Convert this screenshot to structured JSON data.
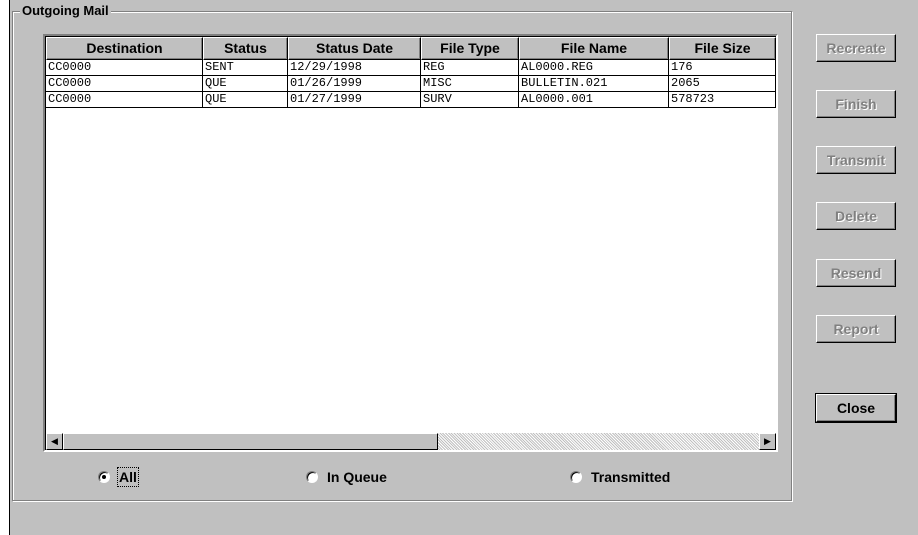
{
  "group_title": "Outgoing Mail",
  "columns": [
    "Destination",
    "Status",
    "Status Date",
    "File Type",
    "File Name",
    "File Size"
  ],
  "rows": [
    [
      "CC0000",
      "SENT",
      "12/29/1998",
      "REG",
      "AL0000.REG",
      "176"
    ],
    [
      "CC0000",
      "QUE",
      "01/26/1999",
      "MISC",
      "BULLETIN.021",
      "2065"
    ],
    [
      "CC0000",
      "QUE",
      "01/27/1999",
      "SURV",
      "AL0000.001",
      "578723"
    ]
  ],
  "scrollbar": {
    "left_arrow": "◀",
    "right_arrow": "▶"
  },
  "filters": [
    {
      "label": "All",
      "selected": true
    },
    {
      "label": "In Queue",
      "selected": false
    },
    {
      "label": "Transmitted",
      "selected": false
    }
  ],
  "buttons": [
    {
      "label": "Recreate",
      "enabled": false
    },
    {
      "label": "Finish",
      "enabled": false
    },
    {
      "label": "Transmit",
      "enabled": false
    },
    {
      "label": "Delete",
      "enabled": false
    },
    {
      "label": "Resend",
      "enabled": false
    },
    {
      "label": "Report",
      "enabled": false
    },
    {
      "label": "Close",
      "enabled": true
    }
  ]
}
